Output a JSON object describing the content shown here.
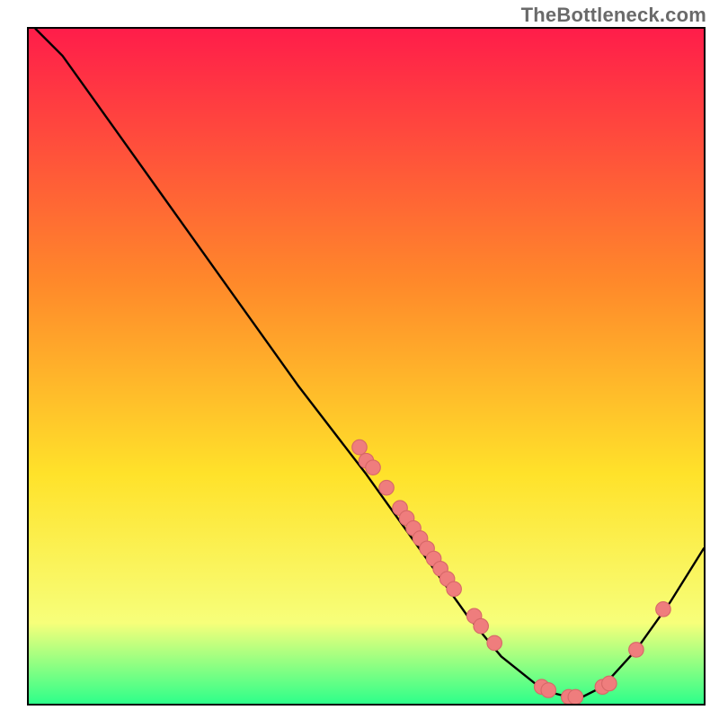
{
  "watermark": "TheBottleneck.com",
  "colors": {
    "gradient_top": "#ff1d4a",
    "gradient_mid1": "#ff8a2a",
    "gradient_mid2": "#ffe22a",
    "gradient_mid3": "#f7ff7a",
    "gradient_bottom": "#2eff8a",
    "curve": "#000000",
    "marker_fill": "#ef7d7d",
    "marker_stroke": "#d76868"
  },
  "chart_data": {
    "type": "line",
    "title": "",
    "xlabel": "",
    "ylabel": "",
    "xlim": [
      0,
      100
    ],
    "ylim": [
      0,
      100
    ],
    "grid": false,
    "legend": false,
    "curve": [
      {
        "x": 1,
        "y": 100
      },
      {
        "x": 5,
        "y": 96
      },
      {
        "x": 10,
        "y": 89
      },
      {
        "x": 20,
        "y": 75
      },
      {
        "x": 30,
        "y": 61
      },
      {
        "x": 40,
        "y": 47
      },
      {
        "x": 50,
        "y": 34
      },
      {
        "x": 55,
        "y": 27
      },
      {
        "x": 60,
        "y": 20
      },
      {
        "x": 65,
        "y": 13
      },
      {
        "x": 70,
        "y": 7
      },
      {
        "x": 75,
        "y": 3
      },
      {
        "x": 78,
        "y": 1.5
      },
      {
        "x": 80,
        "y": 1
      },
      {
        "x": 82,
        "y": 1
      },
      {
        "x": 85,
        "y": 2.5
      },
      {
        "x": 90,
        "y": 8
      },
      {
        "x": 95,
        "y": 15
      },
      {
        "x": 100,
        "y": 23
      }
    ],
    "markers": [
      {
        "x": 49,
        "y": 38
      },
      {
        "x": 50,
        "y": 36
      },
      {
        "x": 51,
        "y": 35
      },
      {
        "x": 53,
        "y": 32
      },
      {
        "x": 55,
        "y": 29
      },
      {
        "x": 56,
        "y": 27.5
      },
      {
        "x": 57,
        "y": 26
      },
      {
        "x": 58,
        "y": 24.5
      },
      {
        "x": 59,
        "y": 23
      },
      {
        "x": 60,
        "y": 21.5
      },
      {
        "x": 61,
        "y": 20
      },
      {
        "x": 62,
        "y": 18.5
      },
      {
        "x": 63,
        "y": 17
      },
      {
        "x": 66,
        "y": 13
      },
      {
        "x": 67,
        "y": 11.5
      },
      {
        "x": 69,
        "y": 9
      },
      {
        "x": 76,
        "y": 2.5
      },
      {
        "x": 77,
        "y": 2
      },
      {
        "x": 80,
        "y": 1
      },
      {
        "x": 81,
        "y": 1
      },
      {
        "x": 85,
        "y": 2.5
      },
      {
        "x": 86,
        "y": 3
      },
      {
        "x": 90,
        "y": 8
      },
      {
        "x": 94,
        "y": 14
      }
    ]
  }
}
